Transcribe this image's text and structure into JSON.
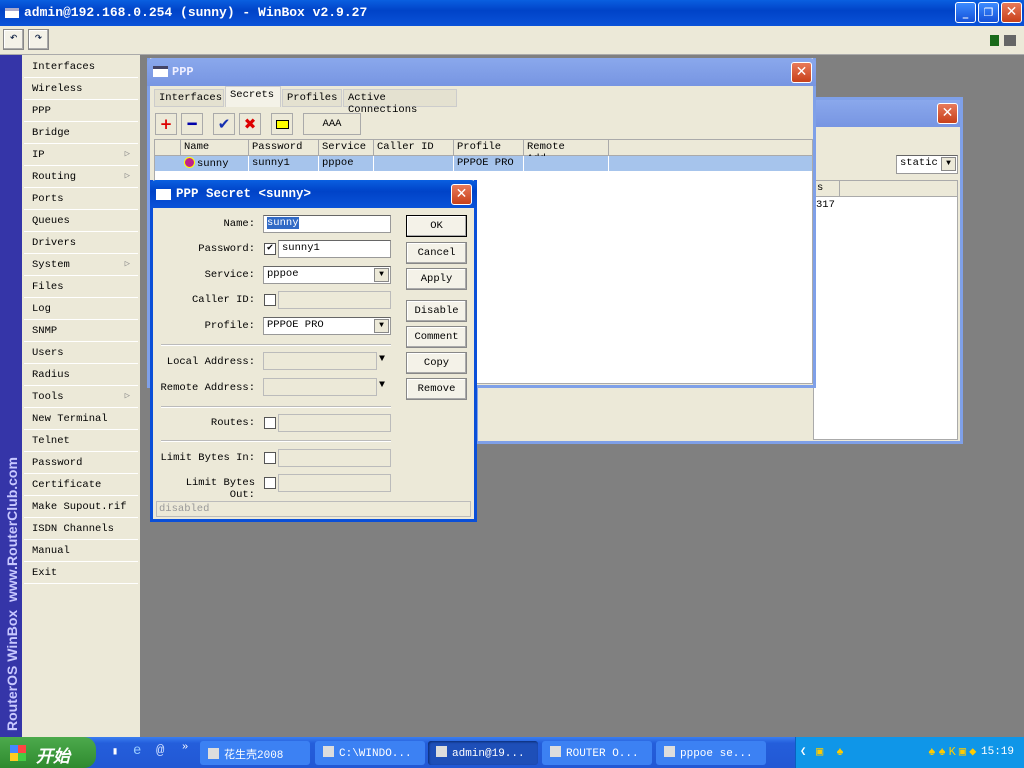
{
  "window": {
    "title": "admin@192.168.0.254 (sunny) - WinBox v2.9.27"
  },
  "toolbar": {
    "undo_icon": "undo-icon",
    "redo_icon": "redo-icon"
  },
  "sidebar": {
    "brand": "RouterOS WinBox",
    "site": "www.RouterClub.com",
    "items": [
      {
        "label": "Interfaces"
      },
      {
        "label": "Wireless"
      },
      {
        "label": "PPP"
      },
      {
        "label": "Bridge"
      },
      {
        "label": "IP",
        "submenu": true
      },
      {
        "label": "Routing",
        "submenu": true
      },
      {
        "label": "Ports"
      },
      {
        "label": "Queues"
      },
      {
        "label": "Drivers"
      },
      {
        "label": "System",
        "submenu": true
      },
      {
        "label": "Files"
      },
      {
        "label": "Log"
      },
      {
        "label": "SNMP"
      },
      {
        "label": "Users"
      },
      {
        "label": "Radius"
      },
      {
        "label": "Tools",
        "submenu": true
      },
      {
        "label": "New Terminal"
      },
      {
        "label": "Telnet"
      },
      {
        "label": "Password"
      },
      {
        "label": "Certificate"
      },
      {
        "label": "Make Supout.rif"
      },
      {
        "label": "ISDN Channels"
      },
      {
        "label": "Manual"
      },
      {
        "label": "Exit"
      }
    ]
  },
  "back_window": {
    "select_value": "static",
    "col_header": "s",
    "cell": "317"
  },
  "ppp": {
    "title": "PPP",
    "tabs": [
      "Interfaces",
      "Secrets",
      "Profiles",
      "Active Connections"
    ],
    "active_tab": "Secrets",
    "aaa_label": "AAA",
    "columns": [
      "Name",
      "Password",
      "Service",
      "Caller ID",
      "Profile",
      "Remote Add..."
    ],
    "rows": [
      {
        "name": "sunny",
        "password": "sunny1",
        "service": "pppoe",
        "caller_id": "",
        "profile": "PPPOE PRO",
        "remote": ""
      }
    ]
  },
  "secret": {
    "title": "PPP Secret <sunny>",
    "labels": {
      "name": "Name:",
      "password": "Password:",
      "service": "Service:",
      "caller_id": "Caller ID:",
      "profile": "Profile:",
      "local": "Local Address:",
      "remote": "Remote Address:",
      "routes": "Routes:",
      "limit_in": "Limit Bytes In:",
      "limit_out": "Limit Bytes Out:"
    },
    "values": {
      "name": "sunny",
      "password": "sunny1",
      "password_checked": true,
      "service": "pppoe",
      "profile": "PPPOE PRO"
    },
    "buttons": [
      "OK",
      "Cancel",
      "Apply",
      "Disable",
      "Comment",
      "Copy",
      "Remove"
    ],
    "status": "disabled"
  },
  "taskbar": {
    "start": "开始",
    "tasks": [
      "花生壳2008",
      "C:\\WINDO...",
      "admin@19...",
      "ROUTER O...",
      "pppoe se..."
    ],
    "active_task": 2,
    "clock": "15:19"
  }
}
